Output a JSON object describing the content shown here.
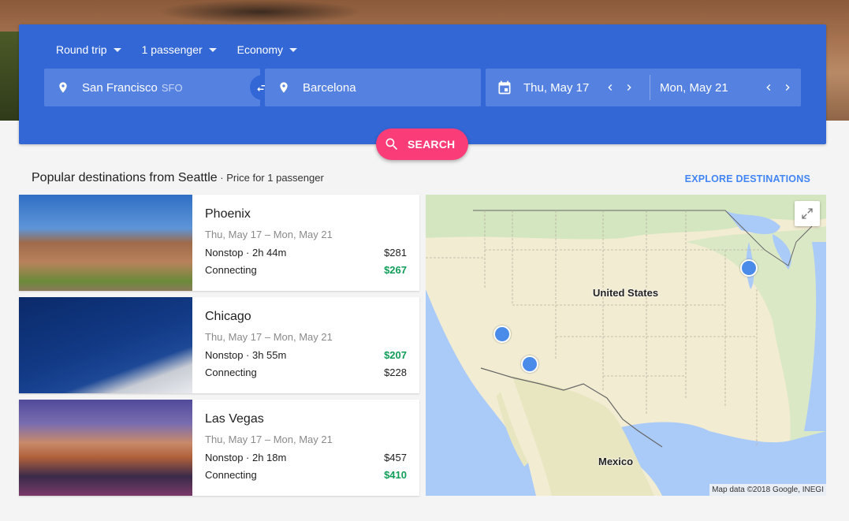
{
  "search": {
    "trip_type": "Round trip",
    "passengers": "1 passenger",
    "cabin": "Economy",
    "origin_city": "San Francisco",
    "origin_code": "SFO",
    "destination": "Barcelona",
    "depart_date": "Thu, May 17",
    "return_date": "Mon, May 21",
    "search_label": "SEARCH"
  },
  "popular": {
    "title": "Popular destinations from Seattle",
    "subtitle": " · Price for 1 passenger",
    "explore_label": "EXPLORE DESTINATIONS",
    "destinations": [
      {
        "city": "Phoenix",
        "dates": "Thu, May 17 – Mon, May 21",
        "nonstop_label": "Nonstop · 2h 44m",
        "nonstop_price": "$281",
        "connecting_label": "Connecting",
        "connecting_price": "$267",
        "best": "connecting"
      },
      {
        "city": "Chicago",
        "dates": "Thu, May 17 – Mon, May 21",
        "nonstop_label": "Nonstop · 3h 55m",
        "nonstop_price": "$207",
        "connecting_label": "Connecting",
        "connecting_price": "$228",
        "best": "nonstop"
      },
      {
        "city": "Las Vegas",
        "dates": "Thu, May 17 – Mon, May 21",
        "nonstop_label": "Nonstop · 2h 18m",
        "nonstop_price": "$457",
        "connecting_label": "Connecting",
        "connecting_price": "$410",
        "best": "connecting"
      }
    ]
  },
  "map": {
    "labels": {
      "us": "United States",
      "mexico": "Mexico"
    },
    "attribution": "Map data ©2018 Google, INEGI",
    "markers": [
      "Las Vegas",
      "Phoenix",
      "Chicago"
    ]
  },
  "colors": {
    "primary": "#3367d6",
    "search_button": "#fa3c78",
    "link": "#4285f4",
    "best_price": "#0f9d58",
    "marker": "#4a8ae8"
  }
}
